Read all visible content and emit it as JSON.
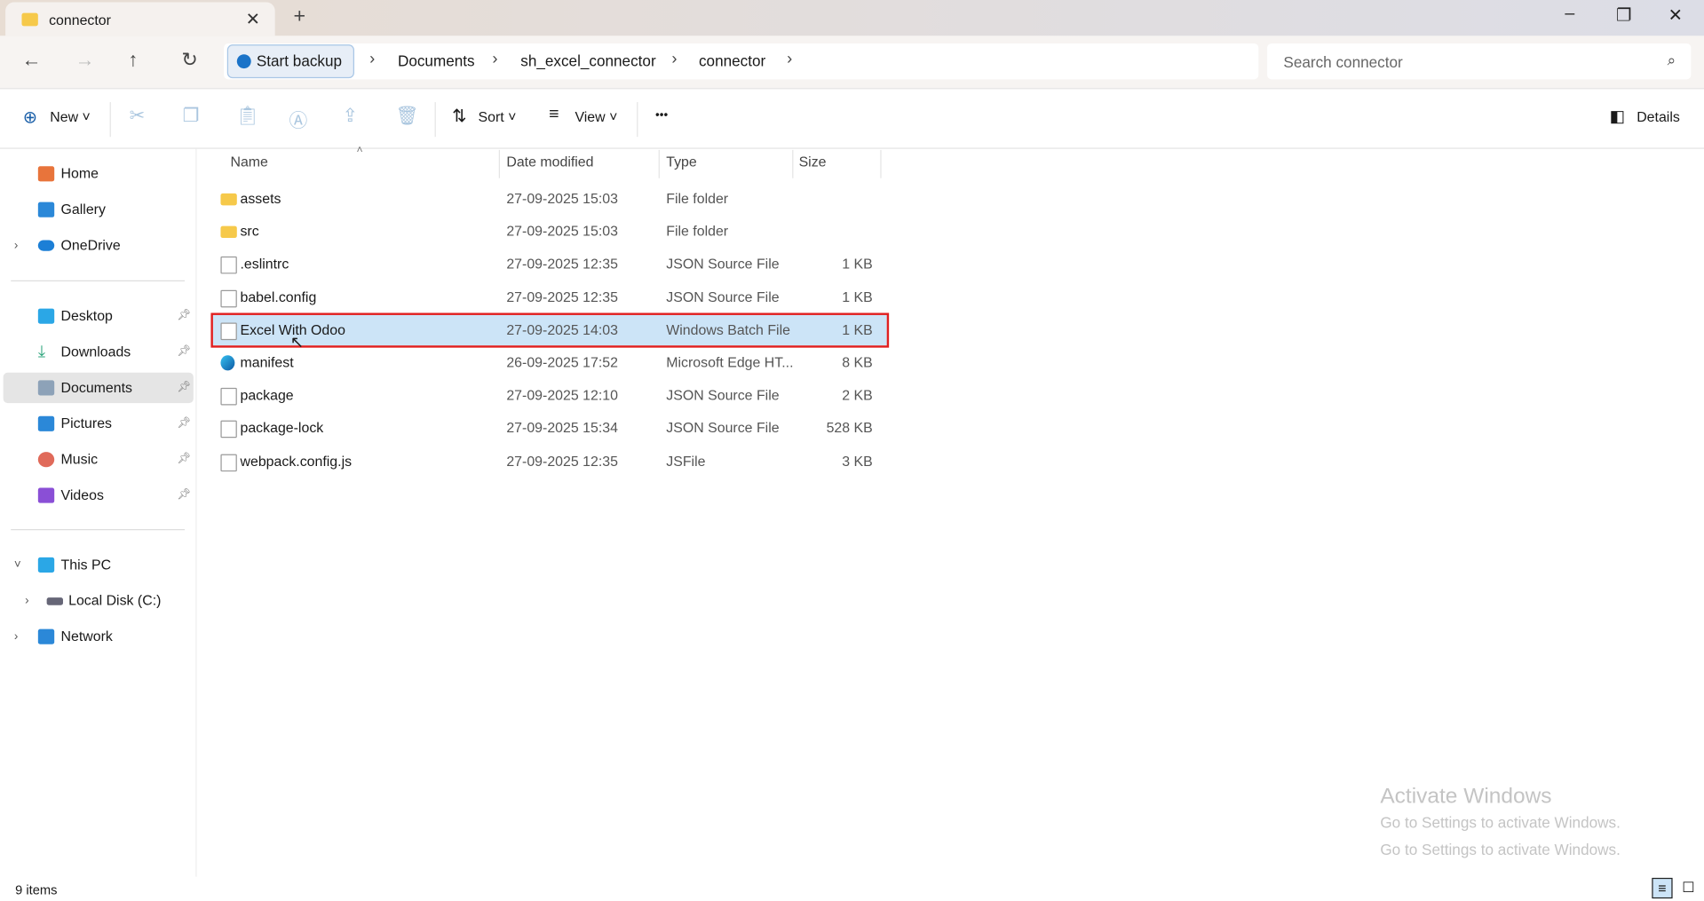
{
  "window": {
    "tab_title": "connector",
    "min": "–",
    "max": "❐",
    "close": "✕"
  },
  "nav": {
    "backup_label": "Start backup",
    "breadcrumbs": [
      "Documents",
      "sh_excel_connector",
      "connector"
    ],
    "search_placeholder": "Search connector"
  },
  "toolbar": {
    "new": "New",
    "sort": "Sort",
    "view": "View",
    "more": "•••",
    "details": "Details"
  },
  "sidebar": {
    "quick": [
      {
        "label": "Home",
        "color": "#e8743b"
      },
      {
        "label": "Gallery",
        "color": "#2b88d8"
      },
      {
        "label": "OneDrive",
        "color": "#1c7fd6"
      }
    ],
    "pinned": [
      {
        "label": "Desktop",
        "color": "#2ba7e6"
      },
      {
        "label": "Downloads",
        "color": "#2aa37a"
      },
      {
        "label": "Documents",
        "color": "#8da2b8"
      },
      {
        "label": "Pictures",
        "color": "#2b88d8"
      },
      {
        "label": "Music",
        "color": "#e06a5a"
      },
      {
        "label": "Videos",
        "color": "#8a4fd6"
      }
    ],
    "tree": [
      {
        "label": "This PC"
      },
      {
        "label": "Local Disk (C:)"
      },
      {
        "label": "Network"
      }
    ]
  },
  "columns": {
    "name": "Name",
    "date": "Date modified",
    "type": "Type",
    "size": "Size"
  },
  "files": [
    {
      "name": "assets",
      "date": "27-09-2025 15:03",
      "type": "File folder",
      "size": "",
      "icon": "folder"
    },
    {
      "name": "src",
      "date": "27-09-2025 15:03",
      "type": "File folder",
      "size": "",
      "icon": "folder"
    },
    {
      "name": ".eslintrc",
      "date": "27-09-2025 12:35",
      "type": "JSON Source File",
      "size": "1 KB",
      "icon": "file"
    },
    {
      "name": "babel.config",
      "date": "27-09-2025 12:35",
      "type": "JSON Source File",
      "size": "1 KB",
      "icon": "file"
    },
    {
      "name": "Excel With Odoo",
      "date": "27-09-2025 14:03",
      "type": "Windows Batch File",
      "size": "1 KB",
      "icon": "file"
    },
    {
      "name": "manifest",
      "date": "26-09-2025 17:52",
      "type": "Microsoft Edge HT...",
      "size": "8 KB",
      "icon": "edge"
    },
    {
      "name": "package",
      "date": "27-09-2025 12:10",
      "type": "JSON Source File",
      "size": "2 KB",
      "icon": "file"
    },
    {
      "name": "package-lock",
      "date": "27-09-2025 15:34",
      "type": "JSON Source File",
      "size": "528 KB",
      "icon": "file"
    },
    {
      "name": "webpack.config.js",
      "date": "27-09-2025 12:35",
      "type": "JSFile",
      "size": "3 KB",
      "icon": "file"
    }
  ],
  "status": {
    "count": "9 items"
  },
  "watermark": {
    "title": "Activate Windows",
    "subtitle": "Go to Settings to activate Windows."
  }
}
